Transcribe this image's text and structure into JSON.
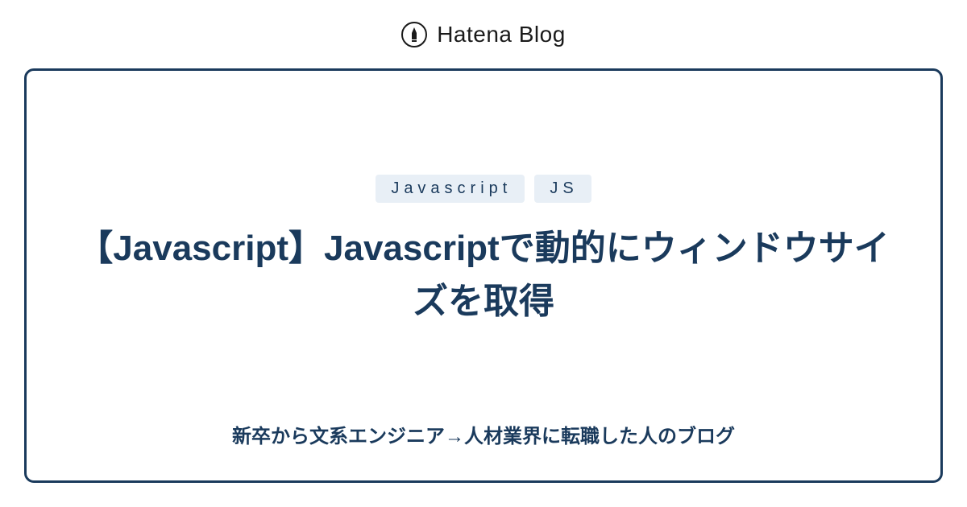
{
  "header": {
    "brand": "Hatena Blog"
  },
  "card": {
    "tags": [
      "Javascript",
      "JS"
    ],
    "title": "【Javascript】Javascriptで動的にウィンドウサイズを取得",
    "subtitle": "新卒から文系エンジニア→人材業界に転職した人のブログ"
  },
  "colors": {
    "primary": "#1a3a5c",
    "tagBg": "#e8eff6",
    "text": "#1a1a1a"
  }
}
